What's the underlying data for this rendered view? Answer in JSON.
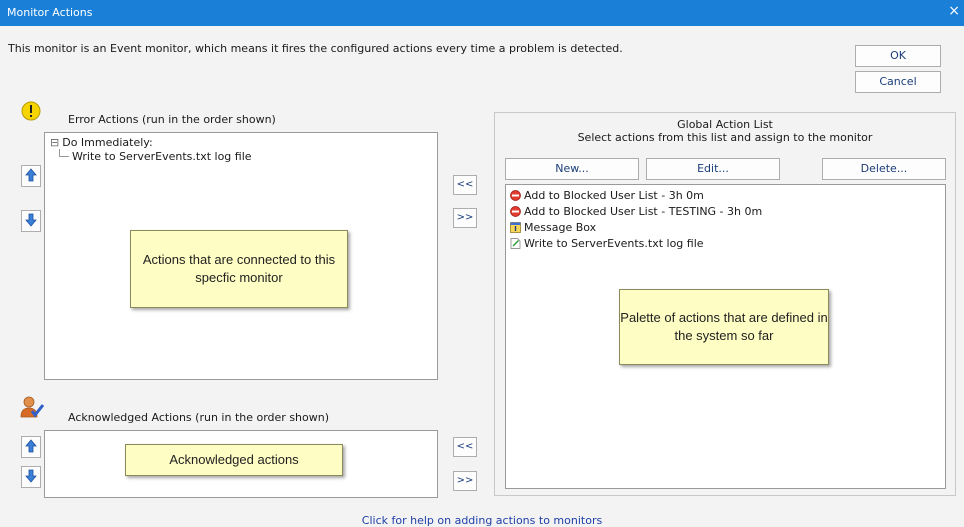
{
  "window": {
    "title": "Monitor Actions",
    "close_glyph": "×",
    "close_icon": "close-icon",
    "titlebar_color": "#1a7fd6"
  },
  "description": "This monitor is an Event monitor, which means it fires the configured actions every time a problem is detected.",
  "buttons": {
    "ok": "OK",
    "cancel": "Cancel",
    "move_left": "<<",
    "move_right": ">>"
  },
  "error_actions": {
    "label": "Error Actions (run in the order shown)",
    "icon": "warning-icon",
    "tree": {
      "expander": "⊟",
      "group_label": "Do Immediately:",
      "children": [
        "Write to ServerEvents.txt log file"
      ]
    },
    "note": "Actions that are connected to this specfic monitor",
    "up_icon": "arrow-up-icon",
    "down_icon": "arrow-down-icon"
  },
  "acknowledged_actions": {
    "label": "Acknowledged Actions (run in the order shown)",
    "icon": "user-check-icon",
    "note": "Acknowledged actions",
    "up_icon": "arrow-up-icon",
    "down_icon": "arrow-down-icon"
  },
  "global_list": {
    "title": "Global Action List",
    "subtitle": "Select actions from this list and assign to the monitor",
    "buttons": {
      "new": "New...",
      "edit": "Edit...",
      "delete": "Delete..."
    },
    "items": [
      {
        "label": "Add to Blocked User List - 3h 0m",
        "icon": "blocked-icon"
      },
      {
        "label": "Add to Blocked User List - TESTING - 3h 0m",
        "icon": "blocked-icon"
      },
      {
        "label": "Message Box",
        "icon": "message-box-icon"
      },
      {
        "label": "Write to ServerEvents.txt log file",
        "icon": "log-file-icon"
      }
    ],
    "note": "Palette of actions that are defined in the system so far"
  },
  "help_link": "Click for help on adding actions to monitors"
}
